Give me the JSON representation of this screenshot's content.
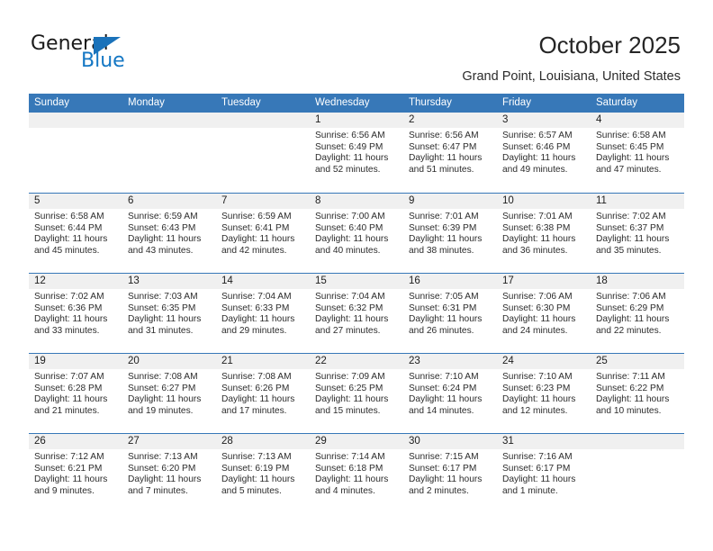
{
  "brand": {
    "name_part1": "General",
    "name_part2": "Blue",
    "accent_color": "#1a72ba",
    "text_color": "#1a1a1a"
  },
  "header": {
    "title": "October 2025",
    "subtitle": "Grand Point, Louisiana, United States"
  },
  "calendar": {
    "header_background": "#3778b8",
    "daynum_background": "#f0f0f0",
    "weekday_labels": [
      "Sunday",
      "Monday",
      "Tuesday",
      "Wednesday",
      "Thursday",
      "Friday",
      "Saturday"
    ],
    "weeks": [
      [
        {
          "day": "",
          "sunrise": "",
          "sunset": "",
          "daylight_line1": "",
          "daylight_line2": ""
        },
        {
          "day": "",
          "sunrise": "",
          "sunset": "",
          "daylight_line1": "",
          "daylight_line2": ""
        },
        {
          "day": "",
          "sunrise": "",
          "sunset": "",
          "daylight_line1": "",
          "daylight_line2": ""
        },
        {
          "day": "1",
          "sunrise": "Sunrise: 6:56 AM",
          "sunset": "Sunset: 6:49 PM",
          "daylight_line1": "Daylight: 11 hours",
          "daylight_line2": "and 52 minutes."
        },
        {
          "day": "2",
          "sunrise": "Sunrise: 6:56 AM",
          "sunset": "Sunset: 6:47 PM",
          "daylight_line1": "Daylight: 11 hours",
          "daylight_line2": "and 51 minutes."
        },
        {
          "day": "3",
          "sunrise": "Sunrise: 6:57 AM",
          "sunset": "Sunset: 6:46 PM",
          "daylight_line1": "Daylight: 11 hours",
          "daylight_line2": "and 49 minutes."
        },
        {
          "day": "4",
          "sunrise": "Sunrise: 6:58 AM",
          "sunset": "Sunset: 6:45 PM",
          "daylight_line1": "Daylight: 11 hours",
          "daylight_line2": "and 47 minutes."
        }
      ],
      [
        {
          "day": "5",
          "sunrise": "Sunrise: 6:58 AM",
          "sunset": "Sunset: 6:44 PM",
          "daylight_line1": "Daylight: 11 hours",
          "daylight_line2": "and 45 minutes."
        },
        {
          "day": "6",
          "sunrise": "Sunrise: 6:59 AM",
          "sunset": "Sunset: 6:43 PM",
          "daylight_line1": "Daylight: 11 hours",
          "daylight_line2": "and 43 minutes."
        },
        {
          "day": "7",
          "sunrise": "Sunrise: 6:59 AM",
          "sunset": "Sunset: 6:41 PM",
          "daylight_line1": "Daylight: 11 hours",
          "daylight_line2": "and 42 minutes."
        },
        {
          "day": "8",
          "sunrise": "Sunrise: 7:00 AM",
          "sunset": "Sunset: 6:40 PM",
          "daylight_line1": "Daylight: 11 hours",
          "daylight_line2": "and 40 minutes."
        },
        {
          "day": "9",
          "sunrise": "Sunrise: 7:01 AM",
          "sunset": "Sunset: 6:39 PM",
          "daylight_line1": "Daylight: 11 hours",
          "daylight_line2": "and 38 minutes."
        },
        {
          "day": "10",
          "sunrise": "Sunrise: 7:01 AM",
          "sunset": "Sunset: 6:38 PM",
          "daylight_line1": "Daylight: 11 hours",
          "daylight_line2": "and 36 minutes."
        },
        {
          "day": "11",
          "sunrise": "Sunrise: 7:02 AM",
          "sunset": "Sunset: 6:37 PM",
          "daylight_line1": "Daylight: 11 hours",
          "daylight_line2": "and 35 minutes."
        }
      ],
      [
        {
          "day": "12",
          "sunrise": "Sunrise: 7:02 AM",
          "sunset": "Sunset: 6:36 PM",
          "daylight_line1": "Daylight: 11 hours",
          "daylight_line2": "and 33 minutes."
        },
        {
          "day": "13",
          "sunrise": "Sunrise: 7:03 AM",
          "sunset": "Sunset: 6:35 PM",
          "daylight_line1": "Daylight: 11 hours",
          "daylight_line2": "and 31 minutes."
        },
        {
          "day": "14",
          "sunrise": "Sunrise: 7:04 AM",
          "sunset": "Sunset: 6:33 PM",
          "daylight_line1": "Daylight: 11 hours",
          "daylight_line2": "and 29 minutes."
        },
        {
          "day": "15",
          "sunrise": "Sunrise: 7:04 AM",
          "sunset": "Sunset: 6:32 PM",
          "daylight_line1": "Daylight: 11 hours",
          "daylight_line2": "and 27 minutes."
        },
        {
          "day": "16",
          "sunrise": "Sunrise: 7:05 AM",
          "sunset": "Sunset: 6:31 PM",
          "daylight_line1": "Daylight: 11 hours",
          "daylight_line2": "and 26 minutes."
        },
        {
          "day": "17",
          "sunrise": "Sunrise: 7:06 AM",
          "sunset": "Sunset: 6:30 PM",
          "daylight_line1": "Daylight: 11 hours",
          "daylight_line2": "and 24 minutes."
        },
        {
          "day": "18",
          "sunrise": "Sunrise: 7:06 AM",
          "sunset": "Sunset: 6:29 PM",
          "daylight_line1": "Daylight: 11 hours",
          "daylight_line2": "and 22 minutes."
        }
      ],
      [
        {
          "day": "19",
          "sunrise": "Sunrise: 7:07 AM",
          "sunset": "Sunset: 6:28 PM",
          "daylight_line1": "Daylight: 11 hours",
          "daylight_line2": "and 21 minutes."
        },
        {
          "day": "20",
          "sunrise": "Sunrise: 7:08 AM",
          "sunset": "Sunset: 6:27 PM",
          "daylight_line1": "Daylight: 11 hours",
          "daylight_line2": "and 19 minutes."
        },
        {
          "day": "21",
          "sunrise": "Sunrise: 7:08 AM",
          "sunset": "Sunset: 6:26 PM",
          "daylight_line1": "Daylight: 11 hours",
          "daylight_line2": "and 17 minutes."
        },
        {
          "day": "22",
          "sunrise": "Sunrise: 7:09 AM",
          "sunset": "Sunset: 6:25 PM",
          "daylight_line1": "Daylight: 11 hours",
          "daylight_line2": "and 15 minutes."
        },
        {
          "day": "23",
          "sunrise": "Sunrise: 7:10 AM",
          "sunset": "Sunset: 6:24 PM",
          "daylight_line1": "Daylight: 11 hours",
          "daylight_line2": "and 14 minutes."
        },
        {
          "day": "24",
          "sunrise": "Sunrise: 7:10 AM",
          "sunset": "Sunset: 6:23 PM",
          "daylight_line1": "Daylight: 11 hours",
          "daylight_line2": "and 12 minutes."
        },
        {
          "day": "25",
          "sunrise": "Sunrise: 7:11 AM",
          "sunset": "Sunset: 6:22 PM",
          "daylight_line1": "Daylight: 11 hours",
          "daylight_line2": "and 10 minutes."
        }
      ],
      [
        {
          "day": "26",
          "sunrise": "Sunrise: 7:12 AM",
          "sunset": "Sunset: 6:21 PM",
          "daylight_line1": "Daylight: 11 hours",
          "daylight_line2": "and 9 minutes."
        },
        {
          "day": "27",
          "sunrise": "Sunrise: 7:13 AM",
          "sunset": "Sunset: 6:20 PM",
          "daylight_line1": "Daylight: 11 hours",
          "daylight_line2": "and 7 minutes."
        },
        {
          "day": "28",
          "sunrise": "Sunrise: 7:13 AM",
          "sunset": "Sunset: 6:19 PM",
          "daylight_line1": "Daylight: 11 hours",
          "daylight_line2": "and 5 minutes."
        },
        {
          "day": "29",
          "sunrise": "Sunrise: 7:14 AM",
          "sunset": "Sunset: 6:18 PM",
          "daylight_line1": "Daylight: 11 hours",
          "daylight_line2": "and 4 minutes."
        },
        {
          "day": "30",
          "sunrise": "Sunrise: 7:15 AM",
          "sunset": "Sunset: 6:17 PM",
          "daylight_line1": "Daylight: 11 hours",
          "daylight_line2": "and 2 minutes."
        },
        {
          "day": "31",
          "sunrise": "Sunrise: 7:16 AM",
          "sunset": "Sunset: 6:17 PM",
          "daylight_line1": "Daylight: 11 hours",
          "daylight_line2": "and 1 minute."
        },
        {
          "day": "",
          "sunrise": "",
          "sunset": "",
          "daylight_line1": "",
          "daylight_line2": ""
        }
      ]
    ]
  }
}
